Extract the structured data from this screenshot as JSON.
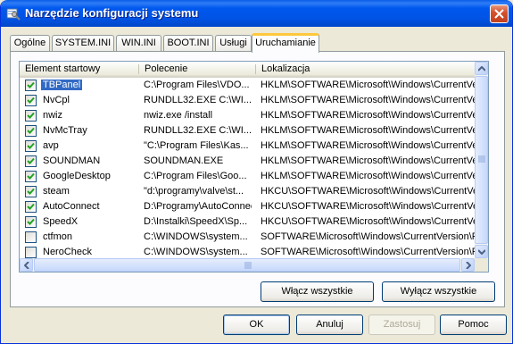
{
  "window": {
    "title": "Narzędzie konfiguracji systemu",
    "icon": "msconfig-icon",
    "close_icon": "close-icon"
  },
  "tabs": [
    {
      "label": "Ogólne",
      "active": false
    },
    {
      "label": "SYSTEM.INI",
      "active": false
    },
    {
      "label": "WIN.INI",
      "active": false
    },
    {
      "label": "BOOT.INI",
      "active": false
    },
    {
      "label": "Usługi",
      "active": false
    },
    {
      "label": "Uruchamianie",
      "active": true
    }
  ],
  "list": {
    "columns": [
      "Element startowy",
      "Polecenie",
      "Lokalizacja"
    ],
    "rows": [
      {
        "checked": true,
        "selected": true,
        "name": "TBPanel",
        "command": "C:\\Program Files\\VDO...",
        "location": "HKLM\\SOFTWARE\\Microsoft\\Windows\\CurrentVer..."
      },
      {
        "checked": true,
        "selected": false,
        "name": "NvCpl",
        "command": "RUNDLL32.EXE C:\\WI...",
        "location": "HKLM\\SOFTWARE\\Microsoft\\Windows\\CurrentVer..."
      },
      {
        "checked": true,
        "selected": false,
        "name": "nwiz",
        "command": "nwiz.exe /install",
        "location": "HKLM\\SOFTWARE\\Microsoft\\Windows\\CurrentVer..."
      },
      {
        "checked": true,
        "selected": false,
        "name": "NvMcTray",
        "command": "RUNDLL32.EXE C:\\WI...",
        "location": "HKLM\\SOFTWARE\\Microsoft\\Windows\\CurrentVer..."
      },
      {
        "checked": true,
        "selected": false,
        "name": "avp",
        "command": "\"C:\\Program Files\\Kas...",
        "location": "HKLM\\SOFTWARE\\Microsoft\\Windows\\CurrentVer..."
      },
      {
        "checked": true,
        "selected": false,
        "name": "SOUNDMAN",
        "command": "SOUNDMAN.EXE",
        "location": "HKLM\\SOFTWARE\\Microsoft\\Windows\\CurrentVer..."
      },
      {
        "checked": true,
        "selected": false,
        "name": "GoogleDesktop",
        "command": "C:\\Program Files\\Goo...",
        "location": "HKLM\\SOFTWARE\\Microsoft\\Windows\\CurrentVer..."
      },
      {
        "checked": true,
        "selected": false,
        "name": "steam",
        "command": "\"d:\\programy\\valve\\st...",
        "location": "HKCU\\SOFTWARE\\Microsoft\\Windows\\CurrentVer..."
      },
      {
        "checked": true,
        "selected": false,
        "name": "AutoConnect",
        "command": "D:\\Programy\\AutoConnect...",
        "location": "HKCU\\SOFTWARE\\Microsoft\\Windows\\CurrentVer..."
      },
      {
        "checked": true,
        "selected": false,
        "name": "SpeedX",
        "command": "D:\\Instalki\\SpeedX\\Sp...",
        "location": "HKCU\\SOFTWARE\\Microsoft\\Windows\\CurrentVer..."
      },
      {
        "checked": false,
        "selected": false,
        "name": "ctfmon",
        "command": "C:\\WINDOWS\\system...",
        "location": "SOFTWARE\\Microsoft\\Windows\\CurrentVersion\\Ru..."
      },
      {
        "checked": false,
        "selected": false,
        "name": "NeroCheck",
        "command": "C:\\WINDOWS\\system...",
        "location": "SOFTWARE\\Microsoft\\Windows\\CurrentVersion\\Ru..."
      }
    ]
  },
  "panel_buttons": {
    "enable_all": "Włącz wszystkie",
    "disable_all": "Wyłącz wszystkie"
  },
  "dialog_buttons": {
    "ok": "OK",
    "cancel": "Anuluj",
    "apply": "Zastosuj",
    "help": "Pomoc"
  },
  "colors": {
    "selection": "#316ac5",
    "titlebar": "#0058ee",
    "active_tab_accent": "#ffc83c",
    "checkmark": "#21a121"
  }
}
